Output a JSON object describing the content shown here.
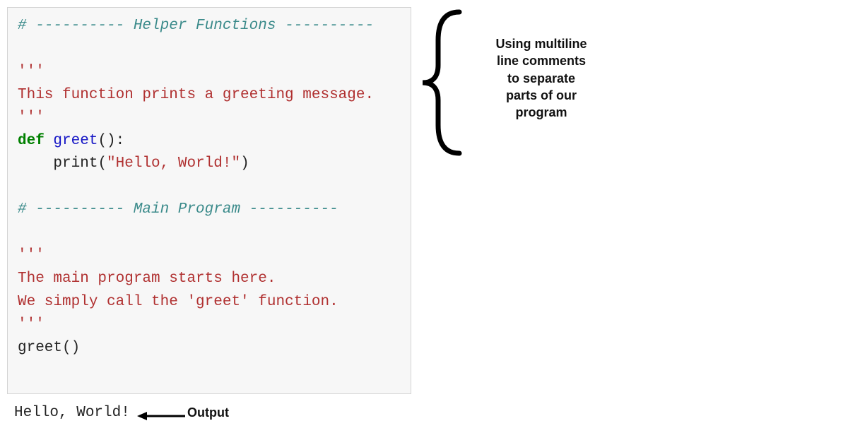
{
  "code": {
    "sep1_prefix": "# ---------- ",
    "sep1_title": "Helper Functions",
    "sep1_suffix": " ----------",
    "triple_open1": "'''",
    "doc1_line": "This function prints a greeting message.",
    "triple_close1": "'''",
    "def_kw": "def",
    "space": " ",
    "func_name": "greet",
    "def_tail": "():",
    "indent": "    ",
    "print_name": "print",
    "lparen": "(",
    "hello_str": "\"Hello, World!\"",
    "rparen": ")",
    "sep2_prefix": "# ---------- ",
    "sep2_title": "Main Program",
    "sep2_suffix": " ----------",
    "triple_open2": "'''",
    "doc2_line1": "The main program starts here.",
    "doc2_line2": "We simply call the 'greet' function.",
    "triple_close2": "'''",
    "call_line": "greet()"
  },
  "output": {
    "text": "Hello, World!",
    "label": "Output"
  },
  "annotation": {
    "line1": "Using multiline",
    "line2": "line comments",
    "line3": "to separate",
    "line4": "parts of our",
    "line5": "program"
  }
}
